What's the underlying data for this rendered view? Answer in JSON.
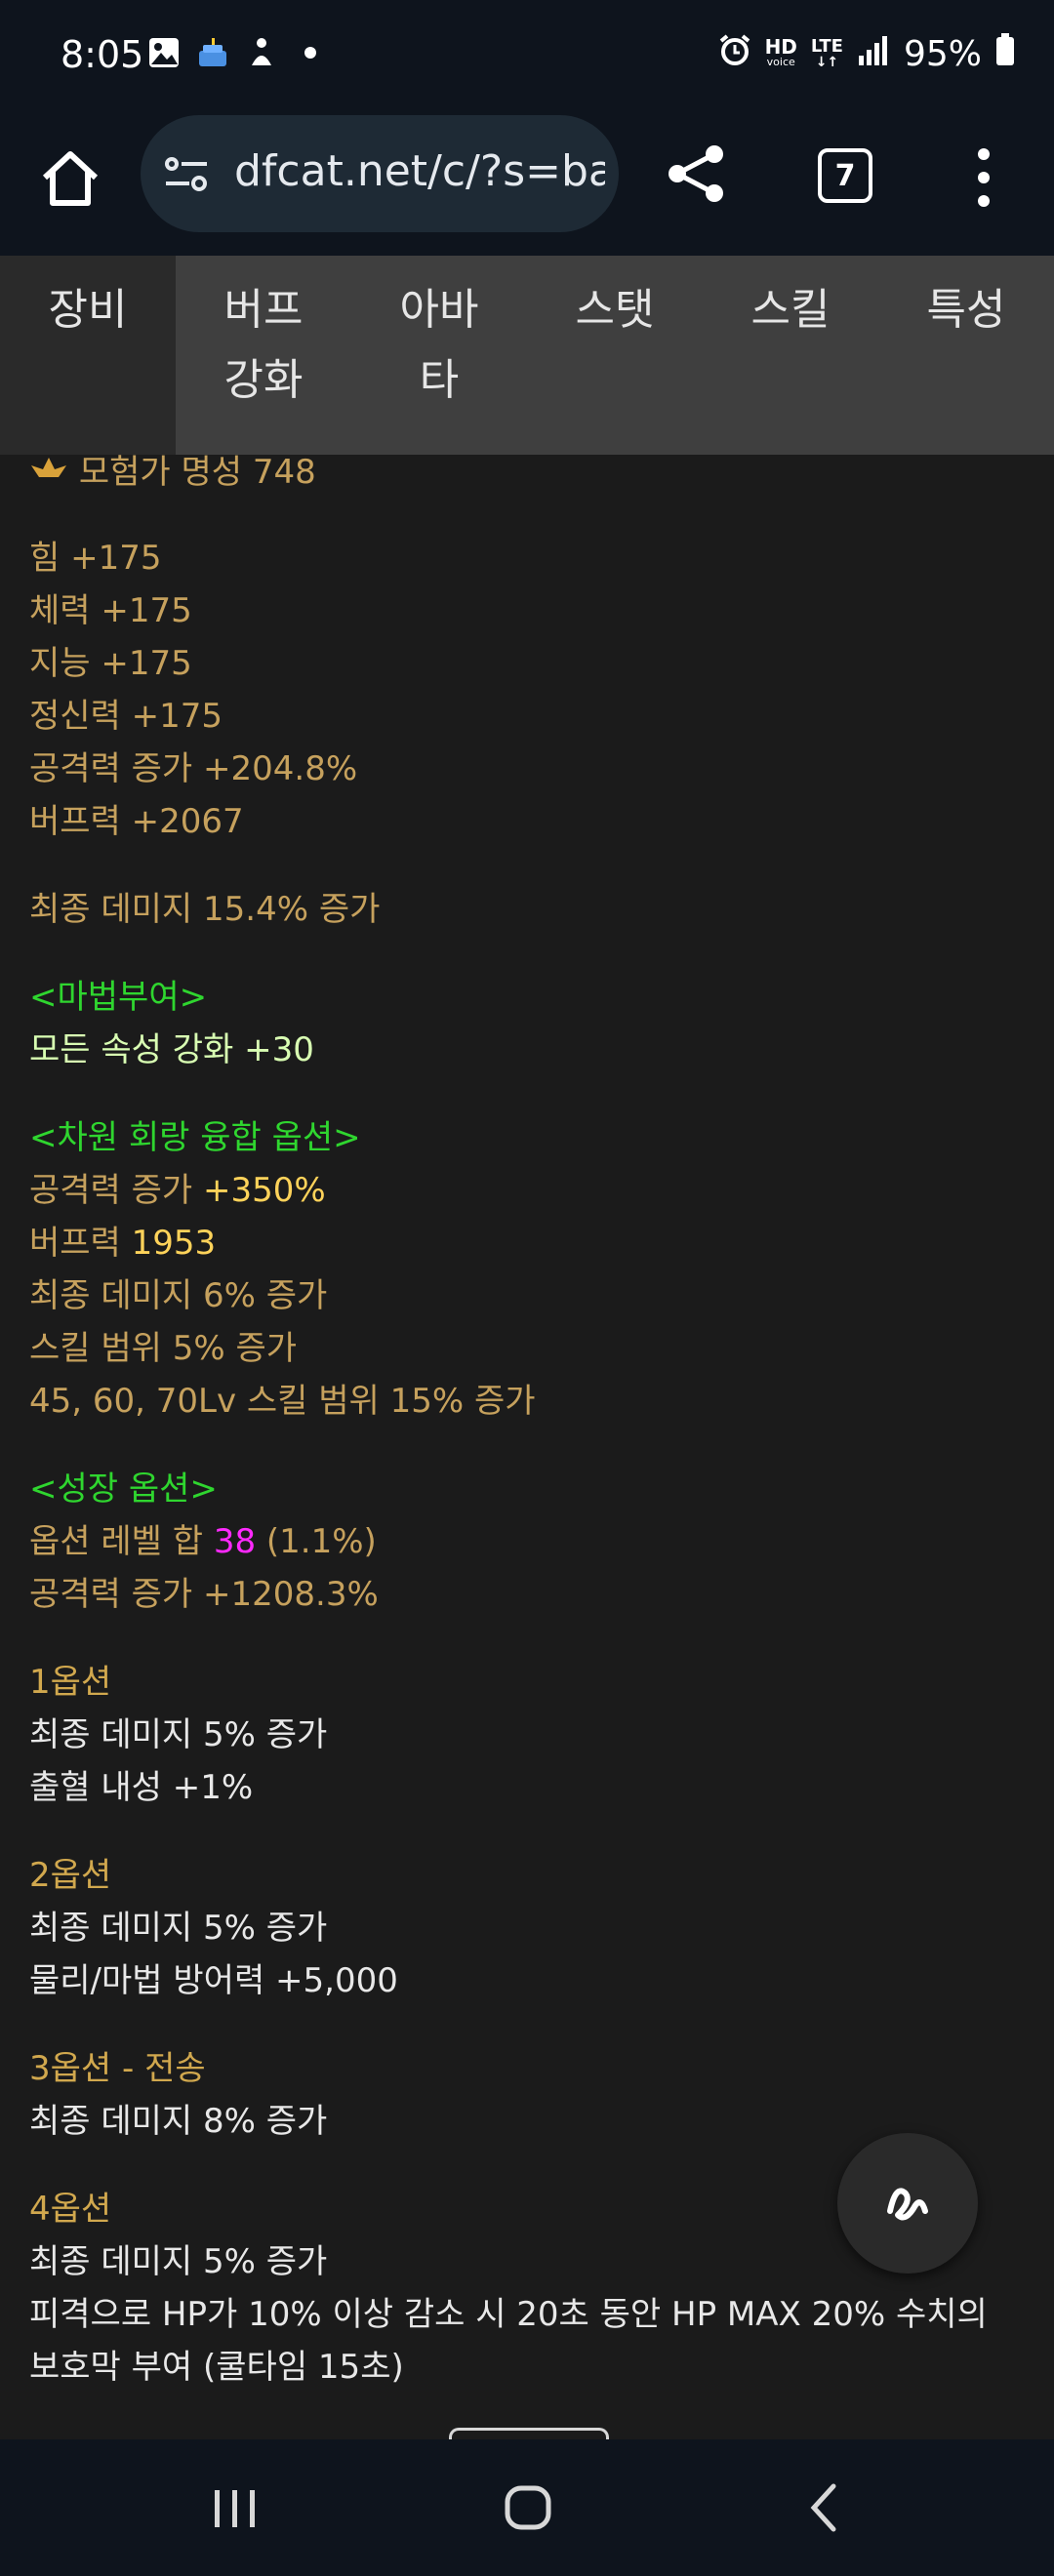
{
  "status": {
    "time": "8:05",
    "battery": "95%",
    "net_hd": "HD",
    "net_voice": "voice",
    "net_lte": "LTE"
  },
  "browser": {
    "url": "dfcat.net/c/?s=ba",
    "tab_count": "7"
  },
  "page_tabs": [
    "장비",
    "버프\n강화",
    "아바\n타",
    "스탯",
    "스킬",
    "특성"
  ],
  "lines": {
    "fame": "모험가 명성 748",
    "str": "힘 +175",
    "vit": "체력 +175",
    "int": "지능 +175",
    "spr": "정신력 +175",
    "atk": "공격력 증가 +204.8%",
    "buff": "버프력 +2067",
    "final_dmg": "최종 데미지 15.4% 증가",
    "enchant_header": "<마법부여>",
    "enchant_all": "모든 속성 강화 +30",
    "fusion_header": "<차원 회랑 융합 옵션>",
    "fusion_atk_label": "공격력 증가 ",
    "fusion_atk_value": "+350%",
    "fusion_buff_label": "버프력 ",
    "fusion_buff_value": "1953",
    "fusion_final": "최종 데미지 6% 증가",
    "fusion_range": "스킬 범위 5% 증가",
    "fusion_range2": "45, 60, 70Lv 스킬 범위 15% 증가",
    "growth_header": "<성장 옵션>",
    "growth_level_label": "옵션 레벨 합 ",
    "growth_level_value": "38",
    "growth_level_pct": " (1.1%)",
    "growth_atk": "공격력 증가 +1208.3%",
    "opt1_title": "1옵션",
    "opt1_a": "최종 데미지 5% 증가",
    "opt1_b": "출혈 내성 +1%",
    "opt2_title": "2옵션",
    "opt2_a": "최종 데미지 5% 증가",
    "opt2_b": "물리/마법 방어력 +5,000",
    "opt3_title": "3옵션 - 전송",
    "opt3_a": "최종 데미지 8% 증가",
    "opt4_title": "4옵션",
    "opt4_a": "최종 데미지 5% 증가",
    "opt4_b": "피격으로 HP가 10% 이상 감소 시 20초 동안 HP MAX 20% 수치의",
    "opt4_c": "보호막 부여 (쿨타임 15초)"
  },
  "icons": {
    "status_left": [
      "gallery-icon",
      "cake-icon",
      "accessibility-icon",
      "dot-icon"
    ],
    "status_right": [
      "alarm-icon",
      "hd-voice-icon",
      "lte-icon",
      "signal-icon",
      "battery-icon"
    ],
    "toolbar": [
      "home-icon",
      "site-settings-icon",
      "share-icon",
      "tabs-icon",
      "more-icon"
    ],
    "nav": [
      "recents-icon",
      "home-nav-icon",
      "back-icon"
    ],
    "fab": "squiggle-fab-icon"
  },
  "colors": {
    "background": "#1b1b1b",
    "stat_text": "#c6a15d",
    "section_header": "#2fd62f",
    "highlight_value": "#ffd35a",
    "level_value": "#ff29ff"
  }
}
